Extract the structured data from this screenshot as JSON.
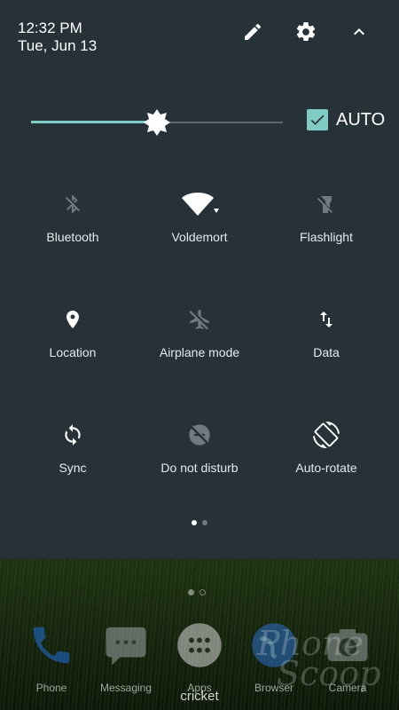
{
  "header": {
    "time": "12:32 PM",
    "date": "Tue, Jun 13",
    "icons": [
      "edit-icon",
      "settings-icon",
      "collapse-icon"
    ]
  },
  "brightness": {
    "level": 0.5,
    "auto_checked": true,
    "auto_label": "AUTO",
    "accent_color": "#80cbc4"
  },
  "tiles": [
    {
      "label": "Bluetooth",
      "icon": "bluetooth-off-icon",
      "active": false
    },
    {
      "label": "Voldemort",
      "icon": "wifi-icon",
      "active": true
    },
    {
      "label": "Flashlight",
      "icon": "flashlight-off-icon",
      "active": false
    },
    {
      "label": "Location",
      "icon": "location-icon",
      "active": true
    },
    {
      "label": "Airplane mode",
      "icon": "airplane-off-icon",
      "active": false
    },
    {
      "label": "Data",
      "icon": "data-arrows-icon",
      "active": true
    },
    {
      "label": "Sync",
      "icon": "sync-icon",
      "active": true
    },
    {
      "label": "Do not disturb",
      "icon": "dnd-off-icon",
      "active": false
    },
    {
      "label": "Auto-rotate",
      "icon": "auto-rotate-icon",
      "active": true
    }
  ],
  "pager": {
    "pages": 2,
    "current": 1
  },
  "home": {
    "dock": [
      {
        "label": "Phone",
        "icon": "phone-icon"
      },
      {
        "label": "Messaging",
        "icon": "messaging-icon"
      },
      {
        "label": "Apps",
        "icon": "apps-icon"
      },
      {
        "label": "Browser",
        "icon": "browser-icon"
      },
      {
        "label": "Camera",
        "icon": "camera-icon"
      }
    ],
    "carrier": "cricket"
  },
  "watermark": {
    "line1": "Phone",
    "line2": "Scoop"
  }
}
